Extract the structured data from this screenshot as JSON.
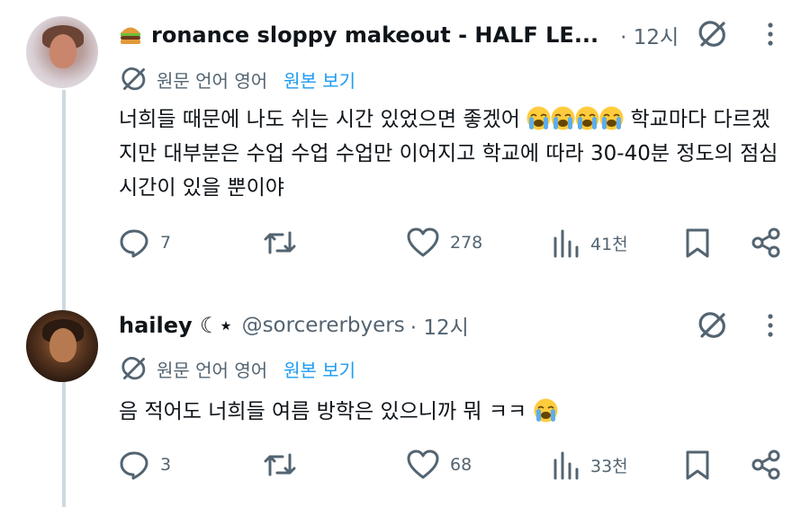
{
  "tweets": [
    {
      "name": "ronance sloppy makeout - HALF LE...",
      "name_emoji": "burger-icon",
      "handle": "",
      "time": "· 12시",
      "translate": {
        "label": "원문 언어 영어",
        "show": "원본 보기"
      },
      "text_before": "너희들 때문에 나도 쉬는 시간 있었으면 좋겠어 ",
      "text_after": " 학교마다 다르겠지만 대부분은 수업 수업 수업만 이어지고 학교에 따라 30-40분 정도의 점심시간이 있을 뿐이야",
      "reply_count": "7",
      "retweet_count": "",
      "like_count": "278",
      "view_count": "41천"
    },
    {
      "name": "hailey ☾⋆",
      "handle": "@sorcererbyers",
      "time": "· 12시",
      "translate": {
        "label": "원문 언어 영어",
        "show": "원본 보기"
      },
      "text_before": "음 적어도 너희들 여름 방학은 있으니까 뭐 ㅋㅋ ",
      "reply_count": "3",
      "retweet_count": "",
      "like_count": "68",
      "view_count": "33천"
    }
  ],
  "colors": {
    "text": "#0f1419",
    "muted": "#536471",
    "link": "#1d9bf0",
    "thread": "#cfd9de"
  }
}
